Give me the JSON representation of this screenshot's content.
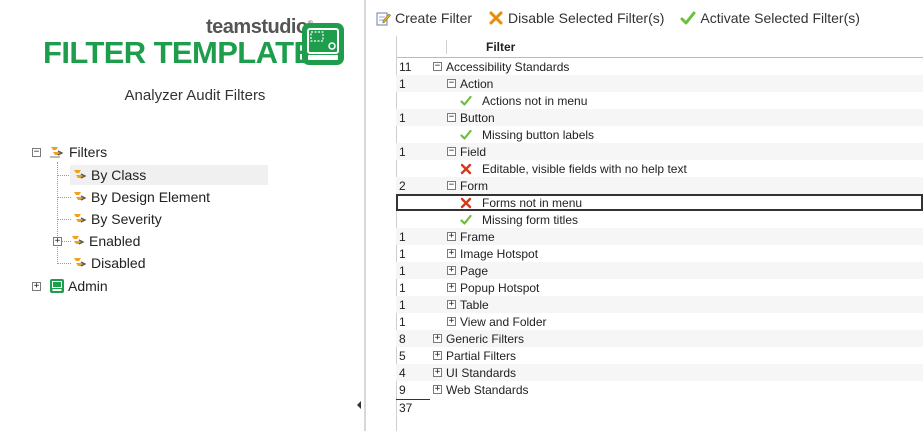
{
  "brand": {
    "company": "teamstudio",
    "trademark": "®",
    "product": "FILTER TEMPLATE"
  },
  "database_title": "Analyzer Audit Filters",
  "nav": {
    "filters": "Filters",
    "by_class": "By Class",
    "by_design_element": "By Design Element",
    "by_severity": "By Severity",
    "enabled": "Enabled",
    "disabled": "Disabled",
    "admin": "Admin"
  },
  "toolbar": {
    "create": "Create Filter",
    "disable": "Disable Selected Filter(s)",
    "activate": "Activate Selected Filter(s)"
  },
  "grid": {
    "header_filter": "Filter",
    "rows": [
      {
        "count": "11",
        "label": "Accessibility Standards"
      },
      {
        "count": "1",
        "label": "Action"
      },
      {
        "count": "",
        "label": "Actions not in menu"
      },
      {
        "count": "1",
        "label": "Button"
      },
      {
        "count": "",
        "label": "Missing button labels"
      },
      {
        "count": "1",
        "label": "Field"
      },
      {
        "count": "",
        "label": "Editable, visible fields with no help text"
      },
      {
        "count": "2",
        "label": "Form"
      },
      {
        "count": "",
        "label": "Forms not in menu"
      },
      {
        "count": "",
        "label": "Missing form titles"
      },
      {
        "count": "1",
        "label": "Frame"
      },
      {
        "count": "1",
        "label": "Image Hotspot"
      },
      {
        "count": "1",
        "label": "Page"
      },
      {
        "count": "1",
        "label": "Popup Hotspot"
      },
      {
        "count": "1",
        "label": "Table"
      },
      {
        "count": "1",
        "label": "View and Folder"
      },
      {
        "count": "8",
        "label": "Generic Filters"
      },
      {
        "count": "5",
        "label": "Partial Filters"
      },
      {
        "count": "4",
        "label": "UI Standards"
      },
      {
        "count": "9",
        "label": "Web Standards"
      }
    ],
    "total": "37"
  },
  "colors": {
    "brand_green": "#1e9e4c",
    "check_green": "#3aa33a",
    "cross_red": "#d23b1e"
  },
  "icons": {
    "nav_filter": "arrow-funnel-icon",
    "admin": "green-database-icon",
    "create": "pencil-notepad-icon",
    "disable": "red-x-icon",
    "activate": "green-check-icon"
  }
}
